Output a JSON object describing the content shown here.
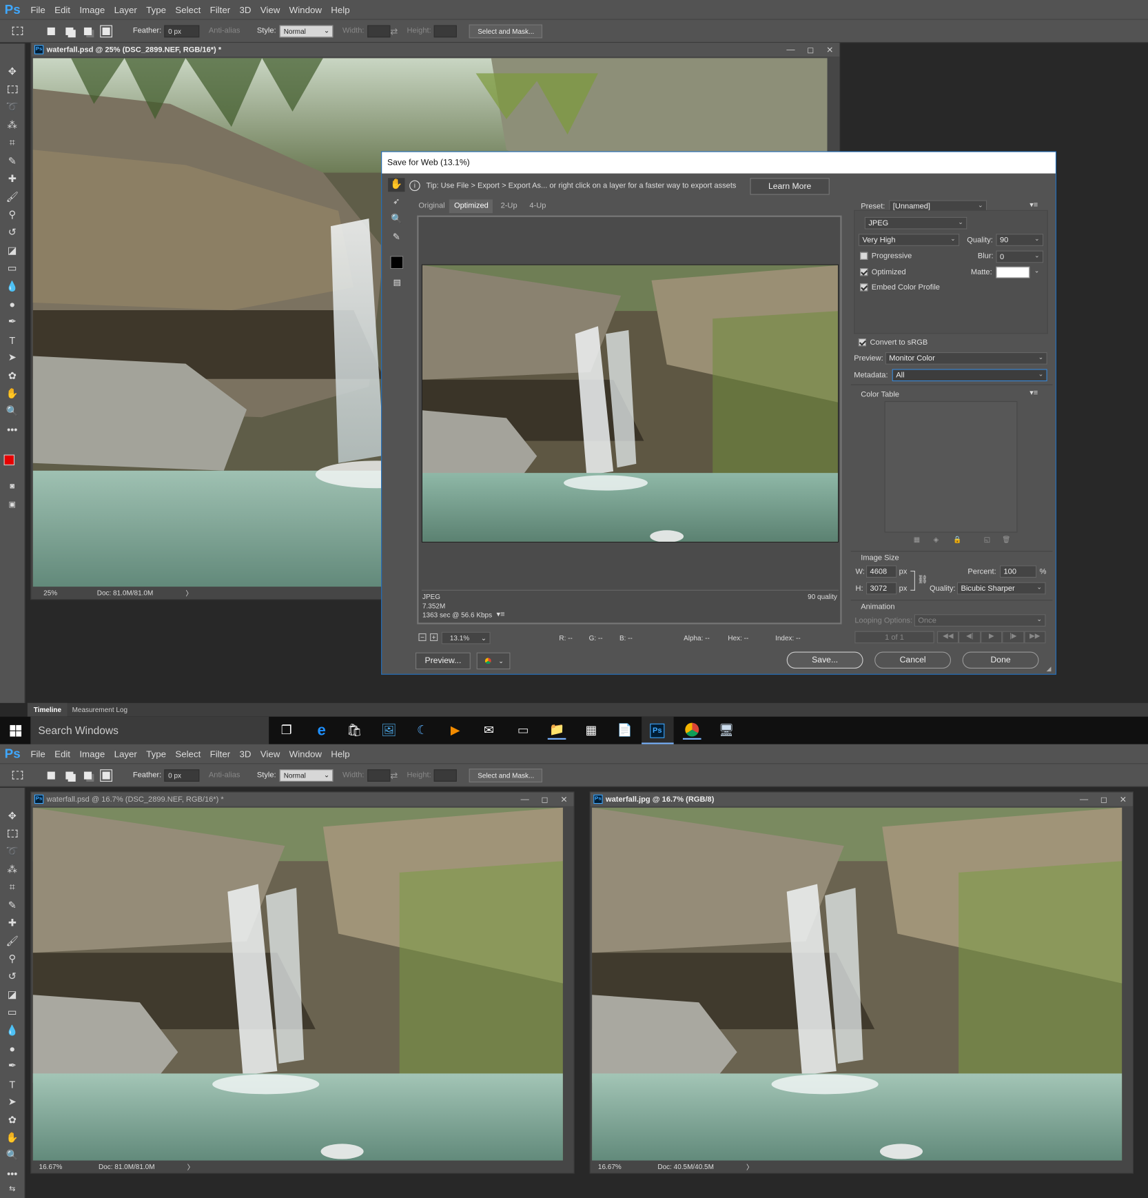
{
  "top": {
    "menu": [
      "File",
      "Edit",
      "Image",
      "Layer",
      "Type",
      "Select",
      "Filter",
      "3D",
      "View",
      "Window",
      "Help"
    ],
    "logo": "Ps",
    "options": {
      "feather_label": "Feather:",
      "feather_value": "0 px",
      "antialias": "Anti-alias",
      "style_label": "Style:",
      "style_value": "Normal",
      "width_label": "Width:",
      "height_label": "Height:",
      "select_mask": "Select and Mask..."
    },
    "doc": {
      "title": "waterfall.psd @ 25% (DSC_2899.NEF, RGB/16*) *",
      "zoom": "25%",
      "docsize": "Doc: 81.0M/81.0M"
    },
    "panel_tabs": [
      "Timeline",
      "Measurement Log"
    ]
  },
  "dialog": {
    "title": "Save for Web (13.1%)",
    "tip": "Tip: Use File > Export > Export As...  or right click on a layer for a faster way to export assets",
    "learn_more": "Learn More",
    "tabs": [
      "Original",
      "Optimized",
      "2-Up",
      "4-Up"
    ],
    "active_tab": "Optimized",
    "preview_info": {
      "format": "JPEG",
      "size": "7.352M",
      "time": "1363 sec @ 56.6 Kbps",
      "quality": "90 quality"
    },
    "zoom": "13.1%",
    "readouts": {
      "r": "R: --",
      "g": "G: --",
      "b": "B: --",
      "alpha": "Alpha: --",
      "hex": "Hex: --",
      "index": "Index: --"
    },
    "preview_btn": "Preview...",
    "save_btn": "Save...",
    "cancel_btn": "Cancel",
    "done_btn": "Done",
    "settings": {
      "preset_label": "Preset:",
      "preset_value": "[Unnamed]",
      "format": "JPEG",
      "quality_level": "Very High",
      "quality_label": "Quality:",
      "quality_value": "90",
      "blur_label": "Blur:",
      "blur_value": "0",
      "matte_label": "Matte:",
      "progressive": "Progressive",
      "optimized": "Optimized",
      "embed": "Embed Color Profile",
      "convert": "Convert to sRGB",
      "preview_label": "Preview:",
      "preview_value": "Monitor Color",
      "metadata_label": "Metadata:",
      "metadata_value": "All",
      "color_table": "Color Table",
      "image_size": "Image Size",
      "w_label": "W:",
      "w_value": "4608",
      "h_label": "H:",
      "h_value": "3072",
      "px": "px",
      "percent_label": "Percent:",
      "percent_value": "100",
      "percent_unit": "%",
      "resample_label": "Quality:",
      "resample_value": "Bicubic Sharper",
      "animation": "Animation",
      "looping_label": "Looping Options:",
      "looping_value": "Once",
      "frame": "1 of 1"
    }
  },
  "taskbar": {
    "search": "Search Windows"
  },
  "bottom": {
    "menu": [
      "File",
      "Edit",
      "Image",
      "Layer",
      "Type",
      "Select",
      "Filter",
      "3D",
      "View",
      "Window",
      "Help"
    ],
    "logo": "Ps",
    "options": {
      "feather_label": "Feather:",
      "feather_value": "0 px",
      "antialias": "Anti-alias",
      "style_label": "Style:",
      "style_value": "Normal",
      "width_label": "Width:",
      "height_label": "Height:",
      "select_mask": "Select and Mask..."
    },
    "doc1": {
      "title": "waterfall.psd @ 16.7% (DSC_2899.NEF, RGB/16*) *",
      "zoom": "16.67%",
      "docsize": "Doc: 81.0M/81.0M"
    },
    "doc2": {
      "title": "waterfall.jpg @ 16.7% (RGB/8)",
      "zoom": "16.67%",
      "docsize": "Doc: 40.5M/40.5M"
    }
  },
  "colors": {
    "ps_blue": "#3fa8ff",
    "ui_gray": "#535353",
    "foreground": "#e60000",
    "background": "#ffffff"
  }
}
